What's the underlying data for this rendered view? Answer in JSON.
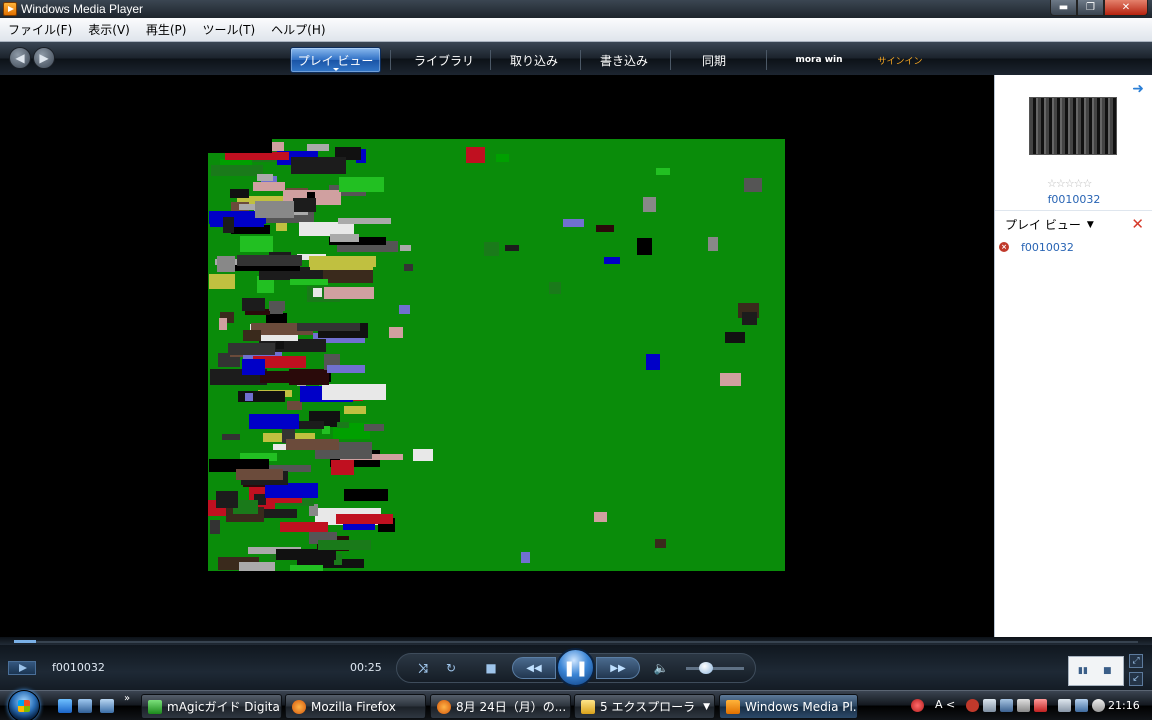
{
  "window": {
    "title": "Windows Media Player"
  },
  "window_controls": {
    "minimize": "▬",
    "maximize": "❐",
    "close": "✕"
  },
  "menu": [
    "ファイル(F)",
    "表示(V)",
    "再生(P)",
    "ツール(T)",
    "ヘルプ(H)"
  ],
  "nav": {
    "back": "◀",
    "forward": "▶",
    "tabs": [
      "プレイ ビュー",
      "ライブラリ",
      "取り込み",
      "書き込み",
      "同期"
    ],
    "mora_label": "mora win",
    "signin_label": "サインイン"
  },
  "rightpane": {
    "title": "f0010032",
    "stars": "☆☆☆☆☆",
    "list_title": "プレイ ビュー",
    "items": [
      "f0010032"
    ]
  },
  "player": {
    "now_playing": "f0010032",
    "time": "00:25",
    "progress": 0.02,
    "volume": 0.35
  },
  "taskbar": {
    "tasks": [
      "mAgicガイド Digital",
      "Mozilla Firefox",
      "8月 24日（月）の...",
      "5 エクスプローラ",
      "Windows Media Pl..."
    ],
    "tray_letters": "A <",
    "clock": "21:16"
  },
  "colors": {
    "video_bg": "#0a8c0a",
    "accent": "#2864b4"
  }
}
